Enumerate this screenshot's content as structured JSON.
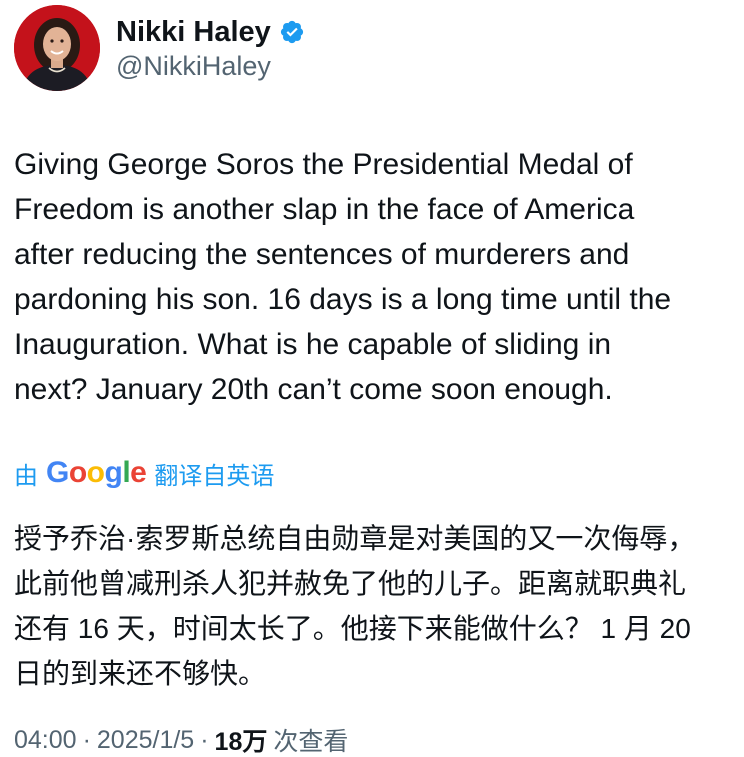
{
  "author": {
    "name": "Nikki Haley",
    "handle": "@NikkiHaley",
    "verified": true,
    "verified_color": "#1d9bf0",
    "avatar_bg": "#c4121b"
  },
  "tweet": {
    "text": "Giving George Soros the Presidential Medal of\nFreedom is another slap in the face of America\nafter reducing the sentences of murderers and\npardoning his son. 16 days is a long time until the\nInauguration. What is he capable of sliding in\nnext? January 20th can’t come soon enough."
  },
  "translation": {
    "by_label": "由",
    "provider_letters": [
      "G",
      "o",
      "o",
      "g",
      "l",
      "e"
    ],
    "label": "翻译自英语",
    "text": "授予乔治·索罗斯总统自由勋章是对美国的又一次侮辱，\n此前他曾减刑杀人犯并赦免了他的儿子。距离就职典礼\n还有 16 天，时间太长了。他接下来能做什么？ 1 月 20\n日的到来还不够快。",
    "link_color": "#1d9bf0"
  },
  "meta": {
    "time": "04:00",
    "separator": "·",
    "date": "2025/1/5",
    "views_count": "18万",
    "views_label": "次查看"
  }
}
